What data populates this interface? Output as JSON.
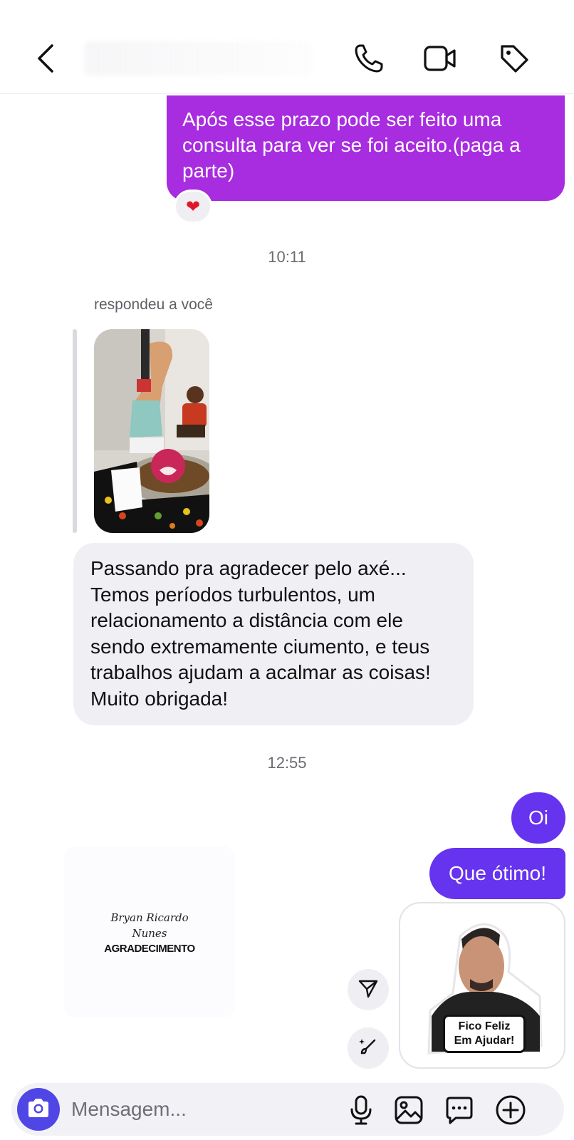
{
  "messages": {
    "outgoing_terms": "Após esse prazo pode ser feito uma consulta para ver se foi aceito.(paga a parte)",
    "reaction": "❤",
    "time_1": "10:11",
    "reply_label": "respondeu a você",
    "incoming_thanks": "Passando pra agradecer pelo axé... Temos períodos turbulentos, um relacionamento a distância com ele sendo extremamente ciumento, e teus trabalhos ajudam a acalmar as coisas! Muito obrigada!",
    "time_2": "12:55",
    "outgoing_oi": "Oi",
    "outgoing_otimo": "Que ótimo!"
  },
  "shared_card": {
    "script_line_1": "Bryan Ricardo",
    "script_line_2": "Nunes",
    "title": "AGRADECIMENTO"
  },
  "sticker": {
    "caption_line_1": "Fico Feliz",
    "caption_line_2": "Em Ajudar!"
  },
  "composer": {
    "placeholder": "Mensagem..."
  },
  "colors": {
    "purple_bubble": "#a82ce0",
    "blue_bubble": "#6633ee",
    "gray_bubble": "#efeff4",
    "camera_button": "#4f46e5"
  },
  "icons": {
    "back": "chevron-left",
    "call": "phone",
    "video": "video-camera",
    "tag": "tag",
    "send_effect": "paper-plane",
    "restyle": "magic-brush",
    "camera": "camera",
    "mic": "microphone",
    "gallery": "image",
    "sticker": "chat-bubble",
    "more": "plus-circle"
  }
}
